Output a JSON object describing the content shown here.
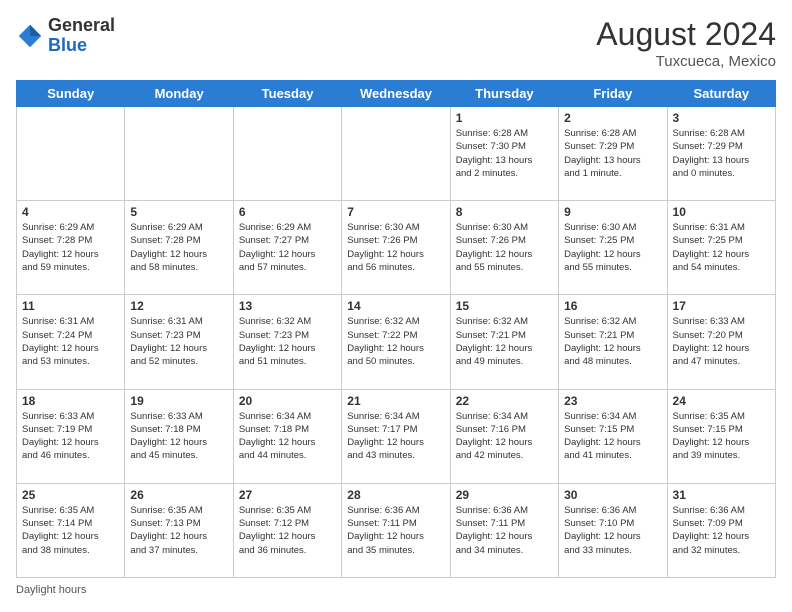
{
  "header": {
    "logo_general": "General",
    "logo_blue": "Blue",
    "month_title": "August 2024",
    "location": "Tuxcueca, Mexico"
  },
  "footer": {
    "label": "Daylight hours"
  },
  "days_of_week": [
    "Sunday",
    "Monday",
    "Tuesday",
    "Wednesday",
    "Thursday",
    "Friday",
    "Saturday"
  ],
  "weeks": [
    [
      {
        "day": "",
        "info": ""
      },
      {
        "day": "",
        "info": ""
      },
      {
        "day": "",
        "info": ""
      },
      {
        "day": "",
        "info": ""
      },
      {
        "day": "1",
        "info": "Sunrise: 6:28 AM\nSunset: 7:30 PM\nDaylight: 13 hours\nand 2 minutes."
      },
      {
        "day": "2",
        "info": "Sunrise: 6:28 AM\nSunset: 7:29 PM\nDaylight: 13 hours\nand 1 minute."
      },
      {
        "day": "3",
        "info": "Sunrise: 6:28 AM\nSunset: 7:29 PM\nDaylight: 13 hours\nand 0 minutes."
      }
    ],
    [
      {
        "day": "4",
        "info": "Sunrise: 6:29 AM\nSunset: 7:28 PM\nDaylight: 12 hours\nand 59 minutes."
      },
      {
        "day": "5",
        "info": "Sunrise: 6:29 AM\nSunset: 7:28 PM\nDaylight: 12 hours\nand 58 minutes."
      },
      {
        "day": "6",
        "info": "Sunrise: 6:29 AM\nSunset: 7:27 PM\nDaylight: 12 hours\nand 57 minutes."
      },
      {
        "day": "7",
        "info": "Sunrise: 6:30 AM\nSunset: 7:26 PM\nDaylight: 12 hours\nand 56 minutes."
      },
      {
        "day": "8",
        "info": "Sunrise: 6:30 AM\nSunset: 7:26 PM\nDaylight: 12 hours\nand 55 minutes."
      },
      {
        "day": "9",
        "info": "Sunrise: 6:30 AM\nSunset: 7:25 PM\nDaylight: 12 hours\nand 55 minutes."
      },
      {
        "day": "10",
        "info": "Sunrise: 6:31 AM\nSunset: 7:25 PM\nDaylight: 12 hours\nand 54 minutes."
      }
    ],
    [
      {
        "day": "11",
        "info": "Sunrise: 6:31 AM\nSunset: 7:24 PM\nDaylight: 12 hours\nand 53 minutes."
      },
      {
        "day": "12",
        "info": "Sunrise: 6:31 AM\nSunset: 7:23 PM\nDaylight: 12 hours\nand 52 minutes."
      },
      {
        "day": "13",
        "info": "Sunrise: 6:32 AM\nSunset: 7:23 PM\nDaylight: 12 hours\nand 51 minutes."
      },
      {
        "day": "14",
        "info": "Sunrise: 6:32 AM\nSunset: 7:22 PM\nDaylight: 12 hours\nand 50 minutes."
      },
      {
        "day": "15",
        "info": "Sunrise: 6:32 AM\nSunset: 7:21 PM\nDaylight: 12 hours\nand 49 minutes."
      },
      {
        "day": "16",
        "info": "Sunrise: 6:32 AM\nSunset: 7:21 PM\nDaylight: 12 hours\nand 48 minutes."
      },
      {
        "day": "17",
        "info": "Sunrise: 6:33 AM\nSunset: 7:20 PM\nDaylight: 12 hours\nand 47 minutes."
      }
    ],
    [
      {
        "day": "18",
        "info": "Sunrise: 6:33 AM\nSunset: 7:19 PM\nDaylight: 12 hours\nand 46 minutes."
      },
      {
        "day": "19",
        "info": "Sunrise: 6:33 AM\nSunset: 7:18 PM\nDaylight: 12 hours\nand 45 minutes."
      },
      {
        "day": "20",
        "info": "Sunrise: 6:34 AM\nSunset: 7:18 PM\nDaylight: 12 hours\nand 44 minutes."
      },
      {
        "day": "21",
        "info": "Sunrise: 6:34 AM\nSunset: 7:17 PM\nDaylight: 12 hours\nand 43 minutes."
      },
      {
        "day": "22",
        "info": "Sunrise: 6:34 AM\nSunset: 7:16 PM\nDaylight: 12 hours\nand 42 minutes."
      },
      {
        "day": "23",
        "info": "Sunrise: 6:34 AM\nSunset: 7:15 PM\nDaylight: 12 hours\nand 41 minutes."
      },
      {
        "day": "24",
        "info": "Sunrise: 6:35 AM\nSunset: 7:15 PM\nDaylight: 12 hours\nand 39 minutes."
      }
    ],
    [
      {
        "day": "25",
        "info": "Sunrise: 6:35 AM\nSunset: 7:14 PM\nDaylight: 12 hours\nand 38 minutes."
      },
      {
        "day": "26",
        "info": "Sunrise: 6:35 AM\nSunset: 7:13 PM\nDaylight: 12 hours\nand 37 minutes."
      },
      {
        "day": "27",
        "info": "Sunrise: 6:35 AM\nSunset: 7:12 PM\nDaylight: 12 hours\nand 36 minutes."
      },
      {
        "day": "28",
        "info": "Sunrise: 6:36 AM\nSunset: 7:11 PM\nDaylight: 12 hours\nand 35 minutes."
      },
      {
        "day": "29",
        "info": "Sunrise: 6:36 AM\nSunset: 7:11 PM\nDaylight: 12 hours\nand 34 minutes."
      },
      {
        "day": "30",
        "info": "Sunrise: 6:36 AM\nSunset: 7:10 PM\nDaylight: 12 hours\nand 33 minutes."
      },
      {
        "day": "31",
        "info": "Sunrise: 6:36 AM\nSunset: 7:09 PM\nDaylight: 12 hours\nand 32 minutes."
      }
    ]
  ]
}
